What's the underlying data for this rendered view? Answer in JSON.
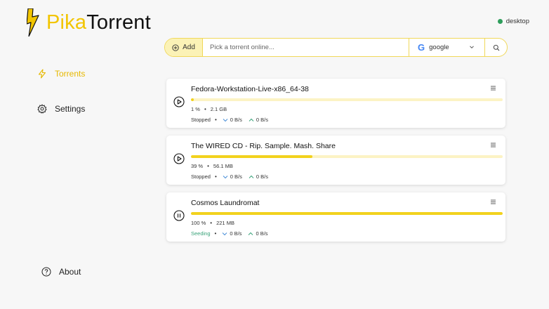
{
  "app": {
    "brand_part1": "Pika",
    "brand_part2": "Torrent"
  },
  "device": {
    "label": "desktop",
    "status_color": "#2e9e5b"
  },
  "search": {
    "add_label": "Add",
    "placeholder": "Pick a torrent online...",
    "engine": "google"
  },
  "sidebar": {
    "items": [
      {
        "label": "Torrents",
        "icon": "lightning-icon",
        "active": true
      },
      {
        "label": "Settings",
        "icon": "gear-icon",
        "active": false
      },
      {
        "label": "About",
        "icon": "question-circle-icon",
        "active": false
      }
    ]
  },
  "torrents": [
    {
      "name": "Fedora-Workstation-Live-x86_64-38",
      "progress_percent": 1,
      "progress_label": "1 %",
      "size": "2.1 GB",
      "status": "Stopped",
      "download_speed": "0 B/s",
      "upload_speed": "0 B/s",
      "action_icon": "play-icon"
    },
    {
      "name": "The WIRED CD - Rip. Sample. Mash. Share",
      "progress_percent": 39,
      "progress_label": "39 %",
      "size": "56.1 MB",
      "status": "Stopped",
      "download_speed": "0 B/s",
      "upload_speed": "0 B/s",
      "action_icon": "play-icon"
    },
    {
      "name": "Cosmos Laundromat",
      "progress_percent": 100,
      "progress_label": "100 %",
      "size": "221 MB",
      "status": "Seeding",
      "download_speed": "0 B/s",
      "upload_speed": "0 B/s",
      "action_icon": "pause-icon"
    }
  ],
  "colors": {
    "accent": "#f2c500",
    "progress_fill": "#f2d21d",
    "progress_track": "#fcf3c4",
    "seeding": "#3aa37a",
    "download_arrow": "#4a90d9",
    "upload_arrow": "#3aa37a"
  }
}
